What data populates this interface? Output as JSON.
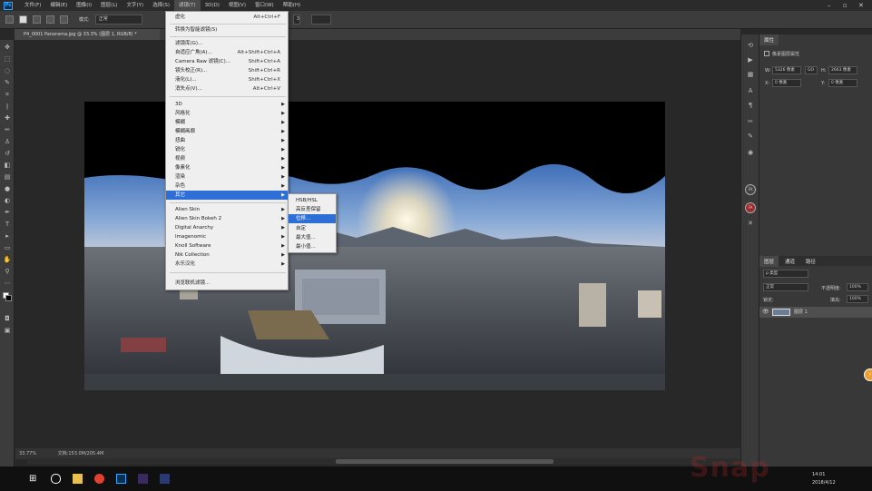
{
  "menubar": {
    "items": [
      "文件(F)",
      "编辑(E)",
      "图像(I)",
      "图层(L)",
      "文字(Y)",
      "选择(S)",
      "滤镜(T)",
      "3D(D)",
      "视图(V)",
      "窗口(W)",
      "帮助(H)"
    ],
    "active_index": 6
  },
  "options": {
    "mode_label": "正常",
    "mode_prefix": "模式:",
    "opacity_value": "3"
  },
  "document": {
    "tab_title": "P4_0001 Panorama.jpg @ 33.3% (图层 1, RGB/8) *",
    "zoom": "33.77%",
    "doc_info": "文档:153.0M/205.4M"
  },
  "filter_menu": {
    "items": [
      {
        "label": "虚化",
        "shortcut": "Alt+Ctrl+F"
      },
      {
        "label": "转换为智能滤镜(S)"
      },
      {
        "label": "滤镜库(G)..."
      },
      {
        "label": "自适应广角(A)...",
        "shortcut": "Alt+Shift+Ctrl+A"
      },
      {
        "label": "Camera Raw 滤镜(C)...",
        "shortcut": "Shift+Ctrl+A"
      },
      {
        "label": "镜头校正(R)...",
        "shortcut": "Shift+Ctrl+R"
      },
      {
        "label": "液化(L)...",
        "shortcut": "Shift+Ctrl+X"
      },
      {
        "label": "消失点(V)...",
        "shortcut": "Alt+Ctrl+V"
      },
      {
        "label": "3D"
      },
      {
        "label": "风格化"
      },
      {
        "label": "模糊"
      },
      {
        "label": "模糊画廊"
      },
      {
        "label": "扭曲"
      },
      {
        "label": "锐化"
      },
      {
        "label": "视频"
      },
      {
        "label": "像素化"
      },
      {
        "label": "渲染"
      },
      {
        "label": "杂色"
      },
      {
        "label": "其它"
      },
      {
        "label": "Alien Skin"
      },
      {
        "label": "Alien Skin Bokeh 2"
      },
      {
        "label": "Digital Anarchy"
      },
      {
        "label": "Imagenomic"
      },
      {
        "label": "Knoll Software"
      },
      {
        "label": "Nik Collection"
      },
      {
        "label": "永乐汉化"
      },
      {
        "label": "浏览联机滤镜..."
      }
    ]
  },
  "submenu": {
    "items": [
      "HSB/HSL",
      "高反差保留",
      "位移...",
      "自定",
      "最大值...",
      "最小值..."
    ],
    "highlight_index": 2
  },
  "properties_panel": {
    "tab": "属性",
    "title": "像素图层属性",
    "w_label": "W:",
    "w_value": "5326 像素",
    "h_label": "H:",
    "h_value": "2663 像素",
    "x_label": "X:",
    "x_value": "0 像素",
    "y_label": "Y:",
    "y_value": "0 像素",
    "go_label": "GO"
  },
  "layers_panel": {
    "tabs": [
      "图层",
      "通道",
      "路径"
    ],
    "filter_label": "ρ 类型",
    "blend_mode": "正常",
    "opacity_label": "不透明度:",
    "opacity_value": "100%",
    "lock_label": "锁定:",
    "fill_label": "填充:",
    "fill_value": "100%",
    "layer_name": "图层 1"
  },
  "taskbar": {
    "time": "14:01",
    "date": "2018/4/12"
  },
  "watermark": "Snap"
}
